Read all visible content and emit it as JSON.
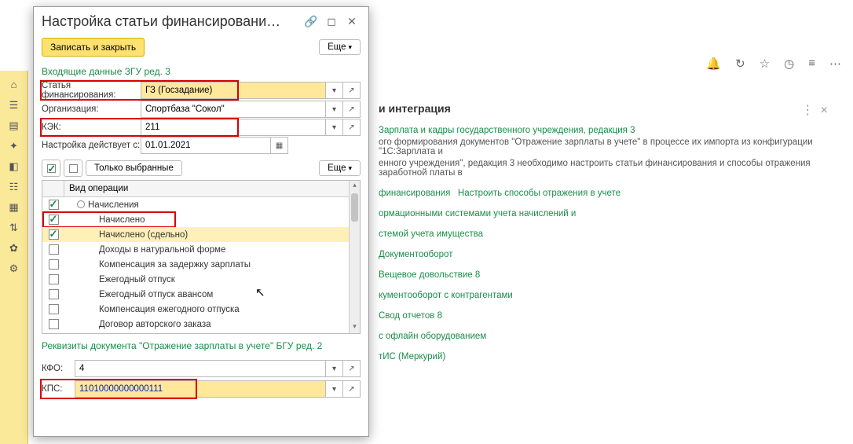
{
  "browser": {
    "icons": [
      "bell",
      "history",
      "star",
      "clock",
      "menu",
      "more"
    ]
  },
  "background": {
    "heading_fragment": "и интеграция",
    "line1_link": "Зарплата и кадры государственного учреждения, редакция 3",
    "para1": "ого формирования документов \"Отражение зарплаты в учете\" в процессе их импорта из конфигурации \"1С:Зарплата и",
    "para2": "енного учреждения\", редакция 3 необходимо настроить статьи финансирования и способы отражения заработной платы в",
    "link1a": "финансирования",
    "link1b": "Настроить способы отражения в учете",
    "link2": "ормационными системами учета начислений и",
    "link3": "стемой учета имущества",
    "link4": "Документооборот",
    "link5": "Вещевое довольствие 8",
    "link6": "кументооборот с контрагентами",
    "link7": "Свод отчетов 8",
    "link8": "с офлайн оборудованием",
    "link9": "тИС (Меркурий)"
  },
  "dialog": {
    "title": "Настройка статьи финансировани…",
    "save_close": "Записать и закрыть",
    "more": "Еще",
    "section1": "Входящие данные ЗГУ ред. 3",
    "fields": {
      "article_label": "Статья финансирования:",
      "article_value": "ГЗ (Госзадание)",
      "org_label": "Организация:",
      "org_value": "Спортбаза \"Сокол\"",
      "kek_label": "КЭК:",
      "kek_value": "211",
      "date_label": "Настройка действует с:",
      "date_value": "01.01.2021"
    },
    "only_selected": "Только выбранные",
    "grid_header": "Вид операции",
    "rows": [
      {
        "label": "Начисления",
        "checked": true,
        "indent": 1,
        "tree": true
      },
      {
        "label": "Начислено",
        "checked": true,
        "indent": 2,
        "highlight_red": true
      },
      {
        "label": "Начислено (сдельно)",
        "checked": true,
        "indent": 2,
        "selected": true
      },
      {
        "label": "Доходы в натуральной форме",
        "checked": false,
        "indent": 2
      },
      {
        "label": "Компенсация за задержку зарплаты",
        "checked": false,
        "indent": 2
      },
      {
        "label": "Ежегодный отпуск",
        "checked": false,
        "indent": 2
      },
      {
        "label": "Ежегодный отпуск авансом",
        "checked": false,
        "indent": 2
      },
      {
        "label": "Компенсация ежегодного отпуска",
        "checked": false,
        "indent": 2
      },
      {
        "label": "Договор авторского заказа",
        "checked": false,
        "indent": 2
      }
    ],
    "section2": "Реквизиты документа \"Отражение зарплаты в учете\" БГУ ред. 2",
    "kfo_label": "КФО:",
    "kfo_value": "4",
    "kps_label": "КПС:",
    "kps_value": "11010000000000111"
  }
}
